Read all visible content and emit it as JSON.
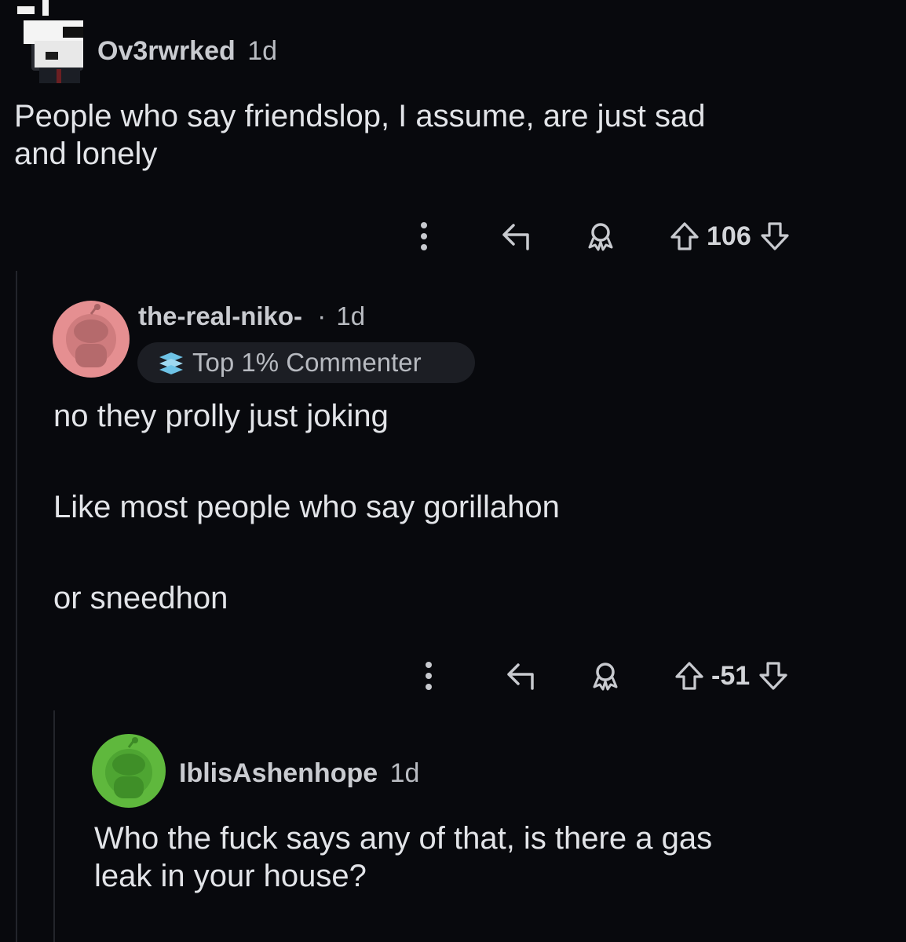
{
  "comments": [
    {
      "username": "Ov3rwrked",
      "time": "1d",
      "body": [
        "People who say friendslop, I assume, are just sad",
        "and lonely"
      ],
      "score": "106"
    },
    {
      "username": "the-real-niko-",
      "separator": "·",
      "time": "1d",
      "badge": "Top 1% Commenter",
      "body": [
        "no they prolly just joking",
        "Like most people who say gorillahon",
        "or sneedhon"
      ],
      "score": "-51"
    },
    {
      "username": "IblisAshenhope",
      "time": "1d",
      "body": [
        "Who the fuck says any of that, is there a gas",
        "leak in your house?"
      ]
    }
  ],
  "icons": {
    "more": "more-vertical-icon",
    "reply": "reply-icon",
    "award": "award-icon",
    "upvote": "upvote-arrow-icon",
    "downvote": "downvote-arrow-icon",
    "badge": "commenter-badge-icon"
  },
  "colors": {
    "background": "#08090d",
    "avatar_pink": "#e58f91",
    "avatar_green": "#5fb83d"
  }
}
